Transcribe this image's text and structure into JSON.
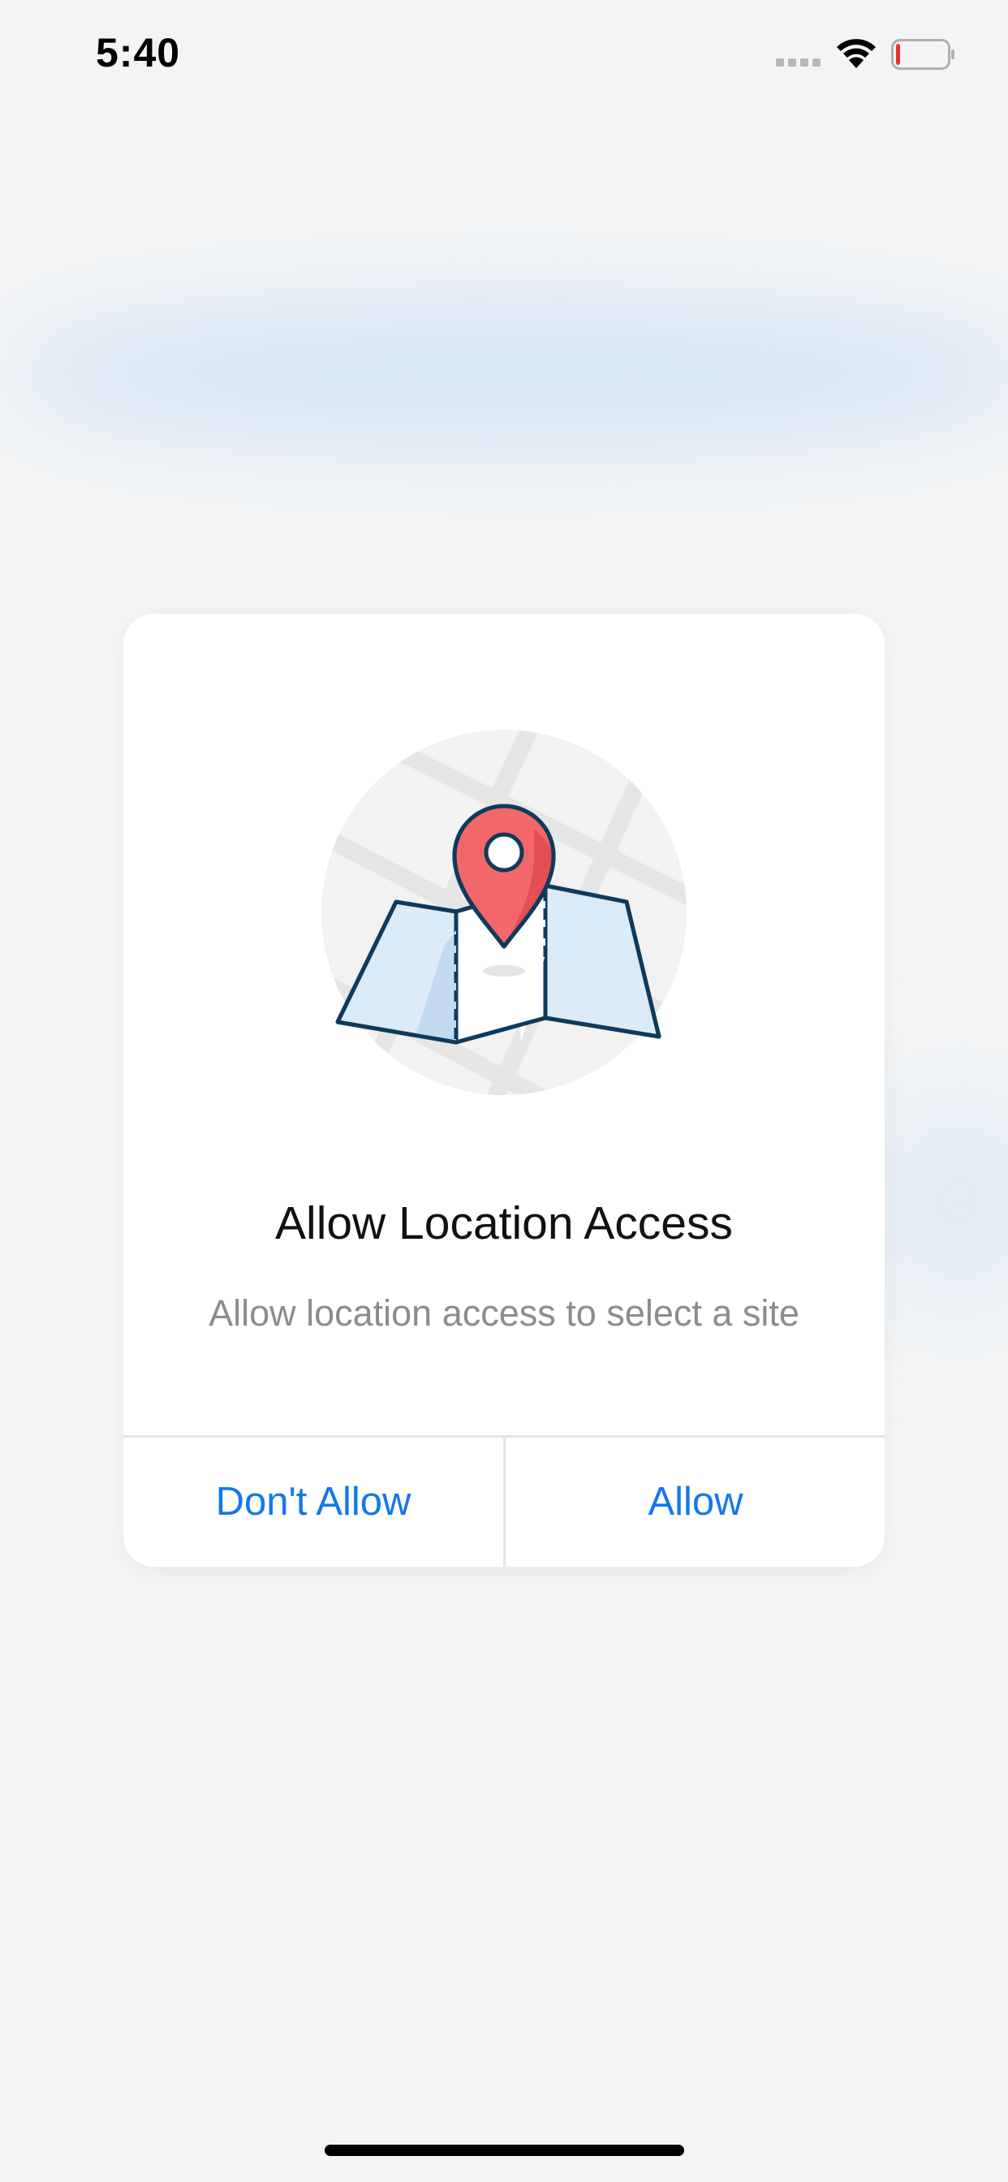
{
  "status_bar": {
    "time": "5:40",
    "icons": [
      "cellular-signal-icon",
      "wifi-icon",
      "battery-icon"
    ],
    "battery_level": 0.08
  },
  "dialog": {
    "illustration": "map-location-pin-icon",
    "title": "Allow Location Access",
    "message": "Allow location access to select a site",
    "buttons": {
      "deny_label": "Don't Allow",
      "allow_label": "Allow"
    }
  },
  "colors": {
    "accent": "#1478E8",
    "pin": "#F2676A",
    "map_outline": "#0F3A5C",
    "map_fill": "#DCEBFA",
    "battery_low": "#E8312F"
  }
}
